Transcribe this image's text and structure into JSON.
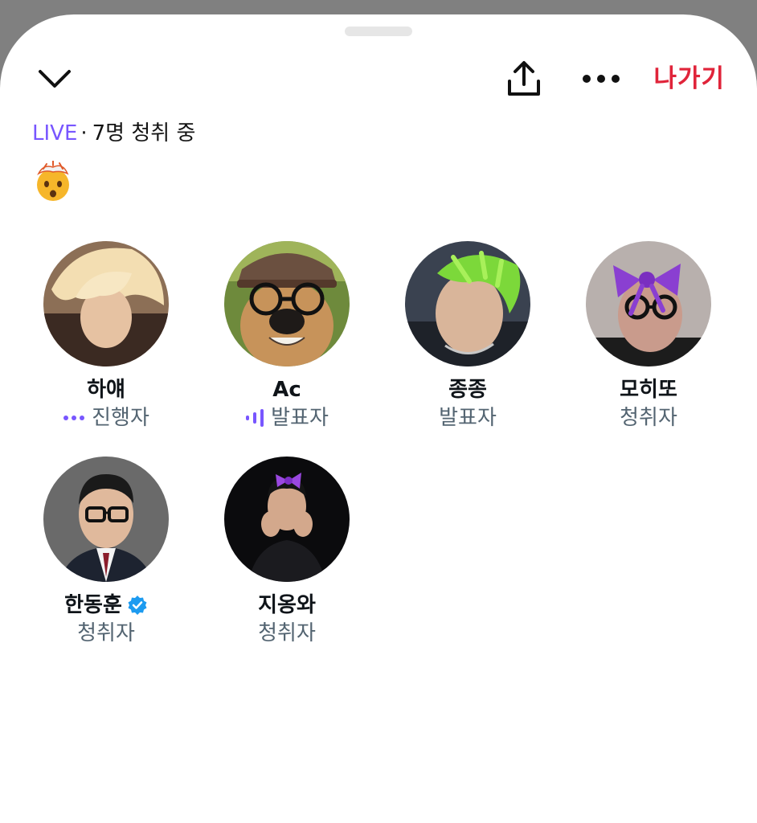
{
  "header": {
    "leave_label": "나가기",
    "icons": [
      "chevron-down-icon",
      "share-icon",
      "more-icon"
    ],
    "accent_color": "#e0243a"
  },
  "status": {
    "live_label": "LIVE",
    "separator": "·",
    "listeners_text": "7명 청취 중",
    "live_color": "#7856ff"
  },
  "topic_emoji": "exploding-head-emoji",
  "participants": [
    {
      "name": "하얘",
      "role": "진행자",
      "role_icon": "ellipsis-icon"
    },
    {
      "name": "Ac",
      "role": "발표자",
      "role_icon": "audio-level-icon"
    },
    {
      "name": "종종",
      "role": "발표자",
      "role_icon": ""
    },
    {
      "name": "모히또",
      "role": "청취자",
      "role_icon": ""
    },
    {
      "name": "한동훈",
      "role": "청취자",
      "role_icon": "verified-badge-icon"
    },
    {
      "name": "지옹와",
      "role": "청취자",
      "role_icon": ""
    }
  ],
  "colors": {
    "role_text": "#536471",
    "verified": "#1d9bf0"
  }
}
